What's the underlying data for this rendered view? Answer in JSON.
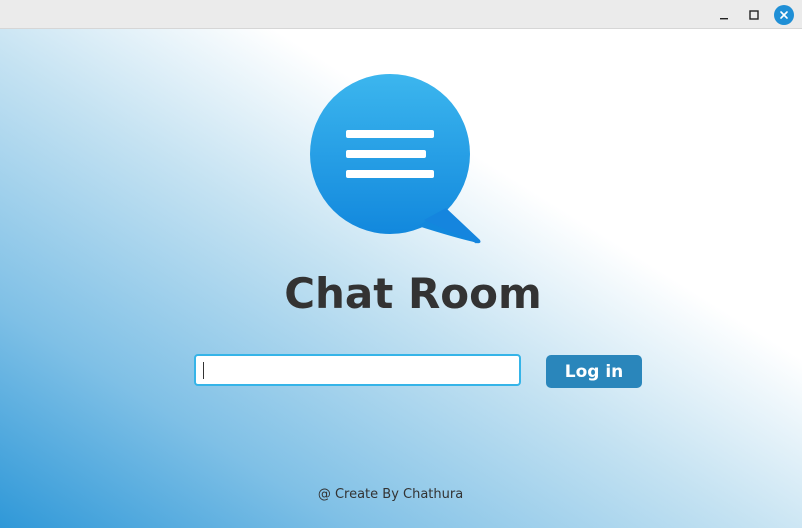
{
  "window": {
    "controls": {
      "minimize_icon": "minimize-icon",
      "maximize_icon": "maximize-icon",
      "close_icon": "close-icon",
      "close_color": "#1f8fd6"
    }
  },
  "login": {
    "logo_icon": "chat-bubble-icon",
    "title": "Chat Room",
    "username_input": {
      "value": "",
      "placeholder": ""
    },
    "login_button_label": "Log in",
    "footer_text": "@ Create By Chathura"
  },
  "colors": {
    "accent": "#2a86bb",
    "logo_blue": "#2ba0e6",
    "input_border": "#35b4e8",
    "title_text": "#333333"
  }
}
